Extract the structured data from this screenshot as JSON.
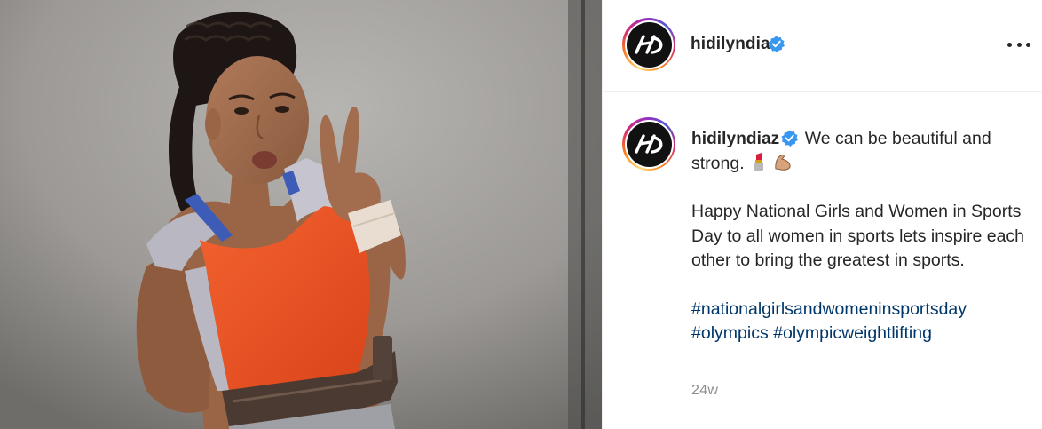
{
  "account": {
    "username": "hidilyndiaz",
    "verified_icon": "verified-badge-icon",
    "avatar_icon": "hd-logo-icon"
  },
  "header": {
    "more_icon": "more-options-icon"
  },
  "caption": {
    "line1": "We can be beautiful and strong.",
    "emojis": [
      "lipstick-emoji",
      "flexed-biceps-emoji"
    ],
    "paragraph2": "Happy National Girls and Women in Sports Day to all women in sports lets inspire each other to bring the greatest in sports.",
    "hashtags": [
      "#nationalgirlsandwomeninsportsday",
      "#olympics",
      "#olympicweightlifting"
    ]
  },
  "timestamp": "24w",
  "colors": {
    "hashtag": "#00376b",
    "verified": "#3897f0",
    "text": "#262626",
    "muted": "#8e8e8e",
    "shirt": "#f0501e"
  }
}
